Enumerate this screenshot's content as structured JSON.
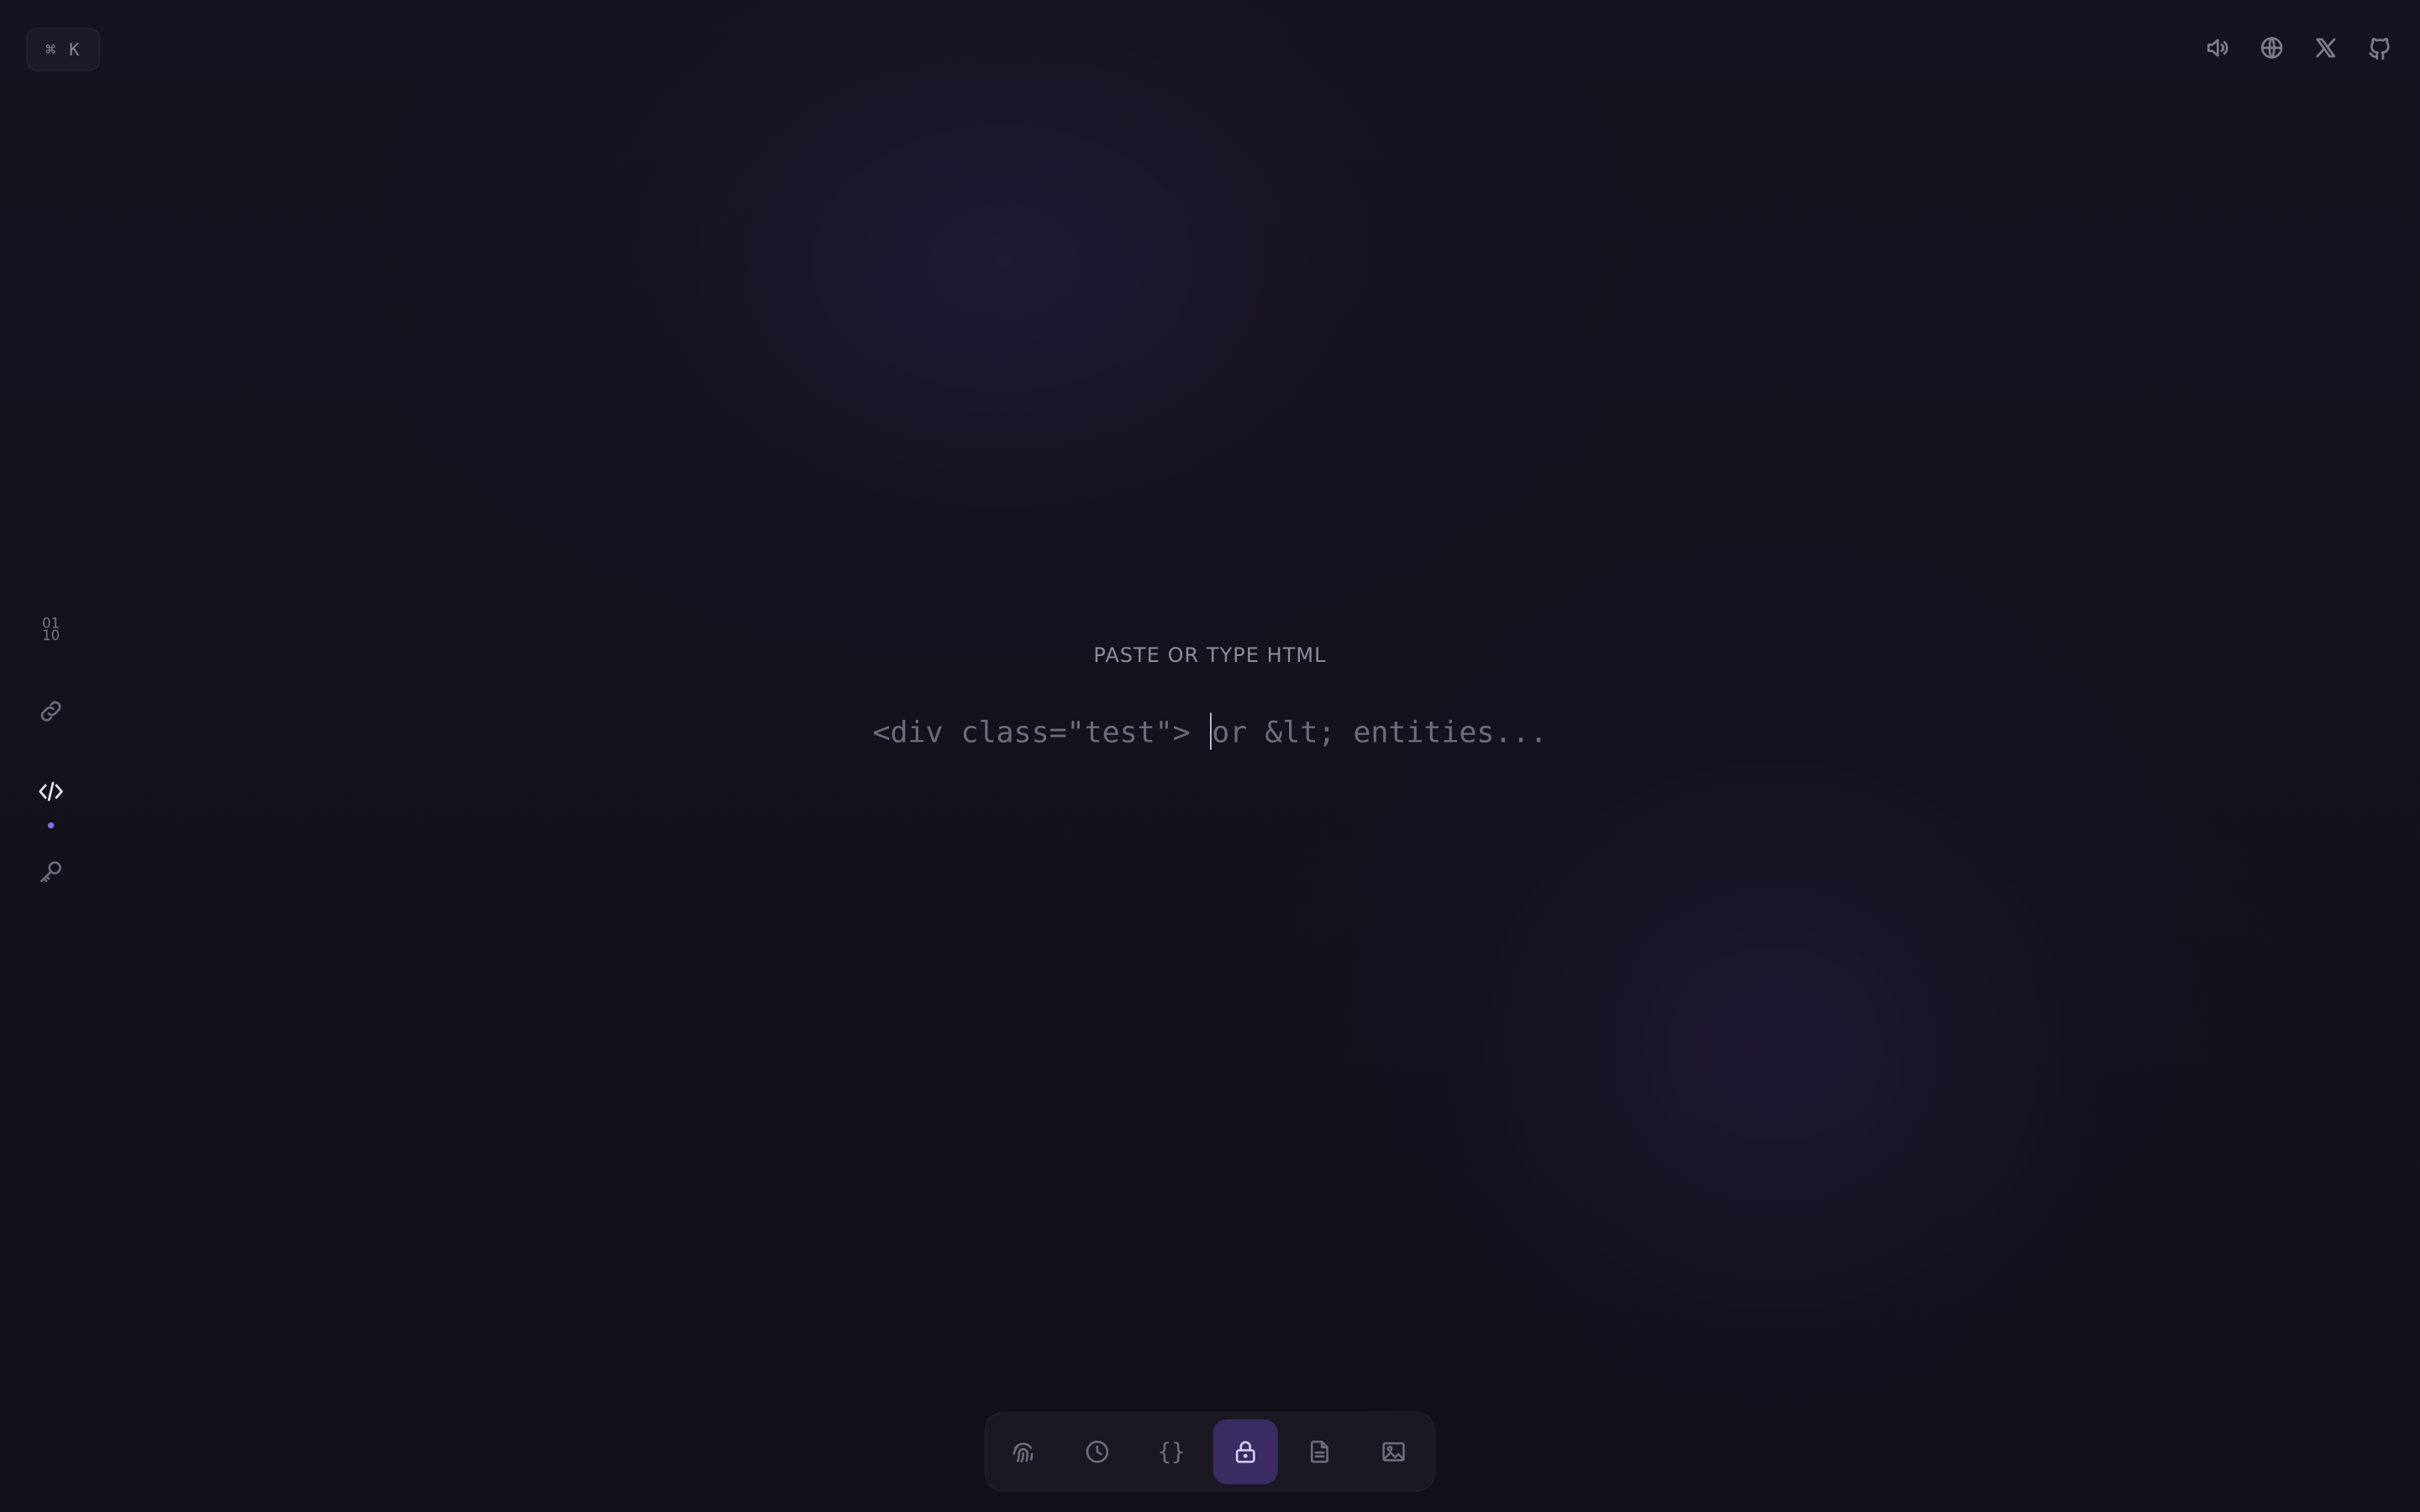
{
  "shortcut": {
    "label": "⌘ K"
  },
  "top_bar": {
    "icons": [
      "speaker-icon",
      "globe-icon",
      "x-logo-icon",
      "github-icon"
    ]
  },
  "sidebar": {
    "items": [
      {
        "name": "binary",
        "label": "01\n10"
      },
      {
        "name": "link",
        "icon": "link-icon"
      },
      {
        "name": "html",
        "icon": "code-icon",
        "active": true
      },
      {
        "name": "key",
        "icon": "key-icon"
      }
    ]
  },
  "main": {
    "heading": "PASTE OR TYPE HTML",
    "placeholder_before_caret": "<div class=\"test\"> ",
    "placeholder_after_caret": "or &lt; entities..."
  },
  "dock": {
    "items": [
      {
        "name": "fingerprint",
        "icon": "fingerprint-icon"
      },
      {
        "name": "clock",
        "icon": "clock-icon"
      },
      {
        "name": "json",
        "label": "{}"
      },
      {
        "name": "lock",
        "icon": "lock-icon",
        "active": true
      },
      {
        "name": "document",
        "icon": "document-icon"
      },
      {
        "name": "image",
        "icon": "image-icon"
      }
    ]
  },
  "colors": {
    "background": "#12111a",
    "accent": "#8b6ce8",
    "active_dock": "#3a2c62"
  }
}
